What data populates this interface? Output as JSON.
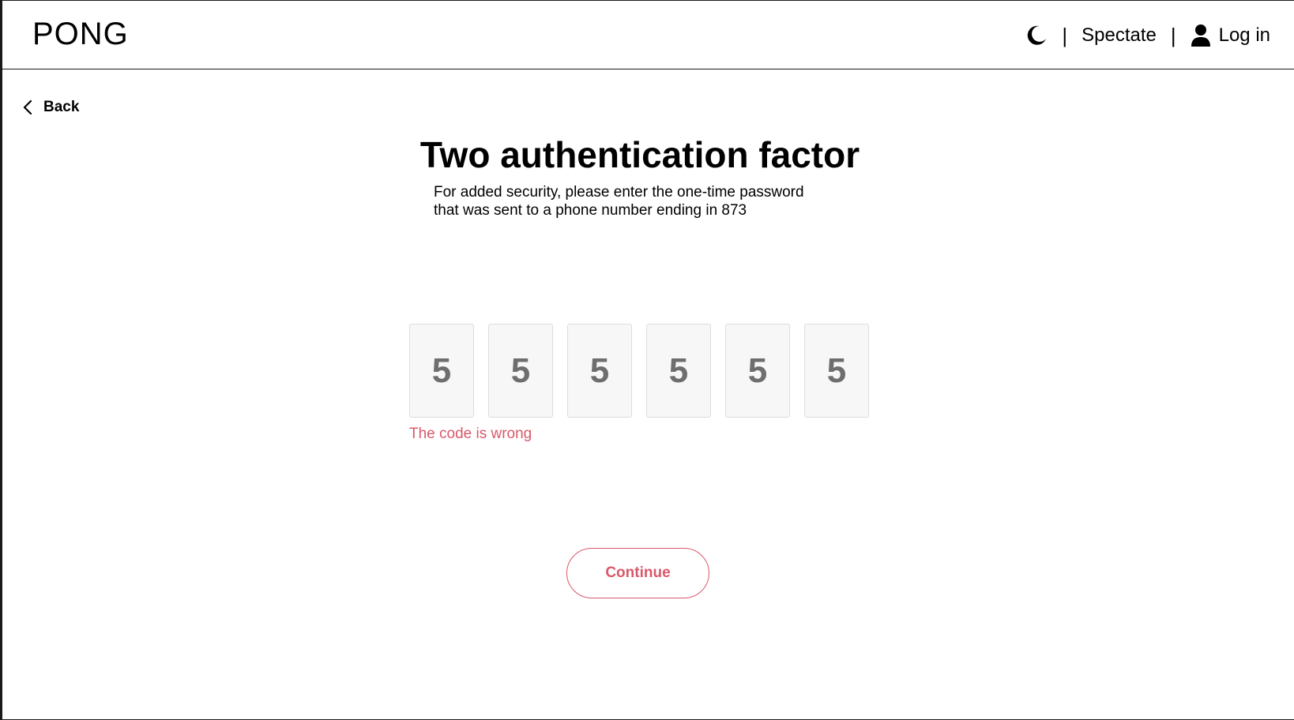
{
  "header": {
    "logo": "PONG",
    "separator": "|",
    "spectate_label": "Spectate",
    "login_label": "Log in",
    "theme_icon": "moon-icon",
    "user_icon": "user-icon"
  },
  "back": {
    "label": "Back",
    "icon": "chevron-left-icon"
  },
  "main": {
    "title": "Two authentication factor",
    "subtitle_line1": "For added security, please enter the one-time password",
    "subtitle_line2": "that was sent to a phone number ending in 873",
    "otp_digits": [
      "5",
      "5",
      "5",
      "5",
      "5",
      "5"
    ],
    "error_text": "The code is wrong",
    "continue_label": "Continue"
  },
  "colors": {
    "accent": "#d9596a",
    "digit": "#6e6e6e",
    "box_bg": "#f7f7f7"
  }
}
